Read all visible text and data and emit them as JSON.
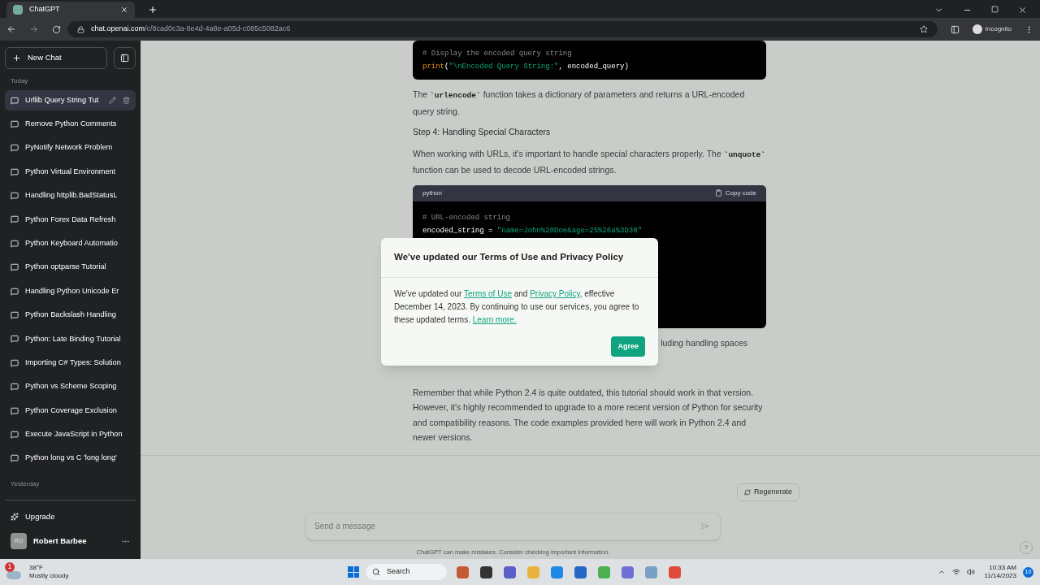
{
  "browser": {
    "tab_title": "ChatGPT",
    "url_host": "chat.openai.com",
    "url_path": "/c/8cad0c3a-8e4d-4a8e-a05d-c085c5082ac6",
    "mode_label": "Incognito"
  },
  "sidebar": {
    "new_chat": "New Chat",
    "sections": [
      {
        "label": "Today",
        "items": [
          {
            "title": "Urllib Query String Tut",
            "selected": true
          },
          {
            "title": "Remove Python Comments",
            "selected": false
          },
          {
            "title": "PyNotify Network Problem",
            "selected": false
          },
          {
            "title": "Python Virtual Environment",
            "selected": false
          },
          {
            "title": "Handling httplib.BadStatusL",
            "selected": false
          },
          {
            "title": "Python Forex Data Refresh",
            "selected": false
          },
          {
            "title": "Python Keyboard Automatio",
            "selected": false
          },
          {
            "title": "Python optparse Tutorial",
            "selected": false
          },
          {
            "title": "Handling Python Unicode Er",
            "selected": false
          },
          {
            "title": "Python Backslash Handling",
            "selected": false
          },
          {
            "title": "Python: Late Binding Tutorial",
            "selected": false
          },
          {
            "title": "Importing C# Types: Solution",
            "selected": false
          },
          {
            "title": "Python vs Scheme Scoping",
            "selected": false
          },
          {
            "title": "Python Coverage Exclusion",
            "selected": false
          },
          {
            "title": "Execute JavaScript in Python",
            "selected": false
          },
          {
            "title": "Python long vs C 'long long'",
            "selected": false
          }
        ]
      },
      {
        "label": "Yesterday"
      }
    ],
    "upgrade": "Upgrade",
    "user": {
      "initials": "RO",
      "name": "Robert Barbee"
    }
  },
  "content": {
    "blocks": [
      {
        "kind": "code",
        "lines": [
          [
            {
              "kind": "comment",
              "text": "# Display the encoded query string"
            }
          ],
          [
            {
              "kind": "keyword",
              "text": "print"
            },
            {
              "kind": "plain",
              "text": "("
            },
            {
              "kind": "string",
              "text": "\"\\nEncoded Query String:\""
            },
            {
              "kind": "plain",
              "text": ", encoded_query)"
            }
          ]
        ]
      },
      {
        "kind": "paragraph",
        "parts": [
          {
            "kind": "text",
            "text": "The "
          },
          {
            "kind": "code",
            "text": "`urlencode`"
          },
          {
            "kind": "text",
            "text": " function takes a dictionary of parameters and returns a URL-encoded query string."
          }
        ]
      },
      {
        "kind": "heading",
        "text": "Step 4: Handling Special Characters"
      },
      {
        "kind": "paragraph",
        "parts": [
          {
            "kind": "text",
            "text": "When working with URLs, it's important to handle special characters properly. The "
          },
          {
            "kind": "code",
            "text": "`unquote`"
          },
          {
            "kind": "text",
            "text": " function can be used to decode URL-encoded strings."
          }
        ]
      },
      {
        "kind": "code",
        "language": "python",
        "copy": "Copy code",
        "lines": [
          [
            {
              "kind": "comment",
              "text": "# URL-encoded string"
            }
          ],
          [
            {
              "kind": "plain",
              "text": "encoded_string = "
            },
            {
              "kind": "string",
              "text": "\"name=John%20Doe&age=25%26a%3D30\""
            }
          ]
        ]
      },
      {
        "kind": "fragment",
        "text": "luding handling spaces"
      },
      {
        "kind": "paragraph",
        "parts": [
          {
            "kind": "text",
            "text": "Remember that while Python 2.4 is quite outdated, this tutorial should work in that version. However, it's highly recommended to upgrade to a more recent version of Python for security and compatibility reasons. The code examples provided here will work in Python 2.4 and newer versions."
          }
        ]
      }
    ],
    "regenerate": "Regenerate",
    "input": {
      "placeholder": "Send a message"
    },
    "disclaimer": "ChatGPT can make mistakes. Consider checking important information.",
    "help": "?"
  },
  "modal": {
    "title": "We've updated our Terms of Use and Privacy Policy",
    "body": [
      {
        "kind": "text",
        "text": "We've updated our "
      },
      {
        "kind": "link",
        "text": "Terms of Use"
      },
      {
        "kind": "text",
        "text": " and "
      },
      {
        "kind": "link",
        "text": "Privacy Policy"
      },
      {
        "kind": "text",
        "text": ", effective December 14, 2023. By continuing to use our services, you agree to these updated terms. "
      },
      {
        "kind": "link",
        "text": "Learn more."
      }
    ],
    "button": "Agree"
  },
  "taskbar": {
    "weather": {
      "badge": "1",
      "temp": "38°F",
      "desc": "Mostly cloudy"
    },
    "search": "Search",
    "time": "10:33 AM",
    "date": "11/14/2023",
    "notifications": "10"
  }
}
